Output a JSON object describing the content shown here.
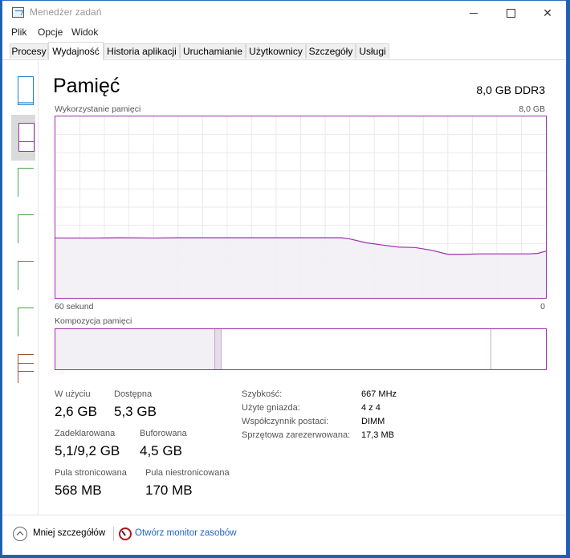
{
  "window": {
    "title": "Menedżer zadań"
  },
  "menu": [
    "Plik",
    "Opcje",
    "Widok"
  ],
  "tabs": [
    "Procesy",
    "Wydajność",
    "Historia aplikacji",
    "Uruchamianie",
    "Użytkownicy",
    "Szczegóły",
    "Usługi"
  ],
  "active_tab": "Wydajność",
  "colors": {
    "memory": "#9b2ea8",
    "cpu": "#1b7fd0",
    "disk": "#4ba34b",
    "ethernet": "#a0522d"
  },
  "header": {
    "title": "Pamięć",
    "total": "8,0 GB DDR3"
  },
  "usage_chart": {
    "label": "Wykorzystanie pamięci",
    "max_label": "8,0 GB",
    "left_label": "60 sekund",
    "right_label": "0"
  },
  "chart_data": {
    "type": "area",
    "x": [
      60,
      58,
      55,
      52,
      48,
      45,
      42,
      38,
      35,
      32,
      28,
      25,
      24,
      22,
      20,
      18,
      16,
      14,
      12,
      10,
      8,
      6,
      4,
      2,
      1,
      0
    ],
    "values": [
      2.64,
      2.64,
      2.64,
      2.65,
      2.64,
      2.65,
      2.65,
      2.65,
      2.65,
      2.65,
      2.65,
      2.65,
      2.6,
      2.43,
      2.33,
      2.24,
      2.22,
      2.1,
      1.92,
      1.92,
      1.94,
      1.94,
      1.94,
      1.94,
      1.96,
      2.06
    ],
    "xlim": [
      60,
      0
    ],
    "ylim": [
      0,
      8
    ],
    "grid": true,
    "fill_color": "#f2eff5",
    "line_color": "#9b2ea8"
  },
  "composition": {
    "label": "Kompozycja pamięci",
    "in_use_frac": 0.325,
    "modified_frac": 0.014,
    "standby_frac": 0.55,
    "free_frac": 0.111
  },
  "stats": {
    "in_use": {
      "label": "W użyciu",
      "value": "2,6 GB"
    },
    "available": {
      "label": "Dostępna",
      "value": "5,3 GB"
    },
    "committed": {
      "label": "Zadeklarowana",
      "value": "5,1/9,2 GB"
    },
    "cached": {
      "label": "Buforowana",
      "value": "4,5 GB"
    },
    "paged_pool": {
      "label": "Pula stronicowana",
      "value": "568 MB"
    },
    "nonpaged_pool": {
      "label": "Pula niestronicowana",
      "value": "170 MB"
    }
  },
  "details": [
    {
      "key": "Szybkość:",
      "value": "667 MHz"
    },
    {
      "key": "Użyte gniazda:",
      "value": "4 z 4"
    },
    {
      "key": "Współczynnik postaci:",
      "value": "DIMM"
    },
    {
      "key": "Sprzętowa zarezerwowana:",
      "value": "17,3 MB"
    }
  ],
  "footer": {
    "fewer_details": "Mniej szczegółów",
    "resource_monitor": "Otwórz monitor zasobów"
  }
}
